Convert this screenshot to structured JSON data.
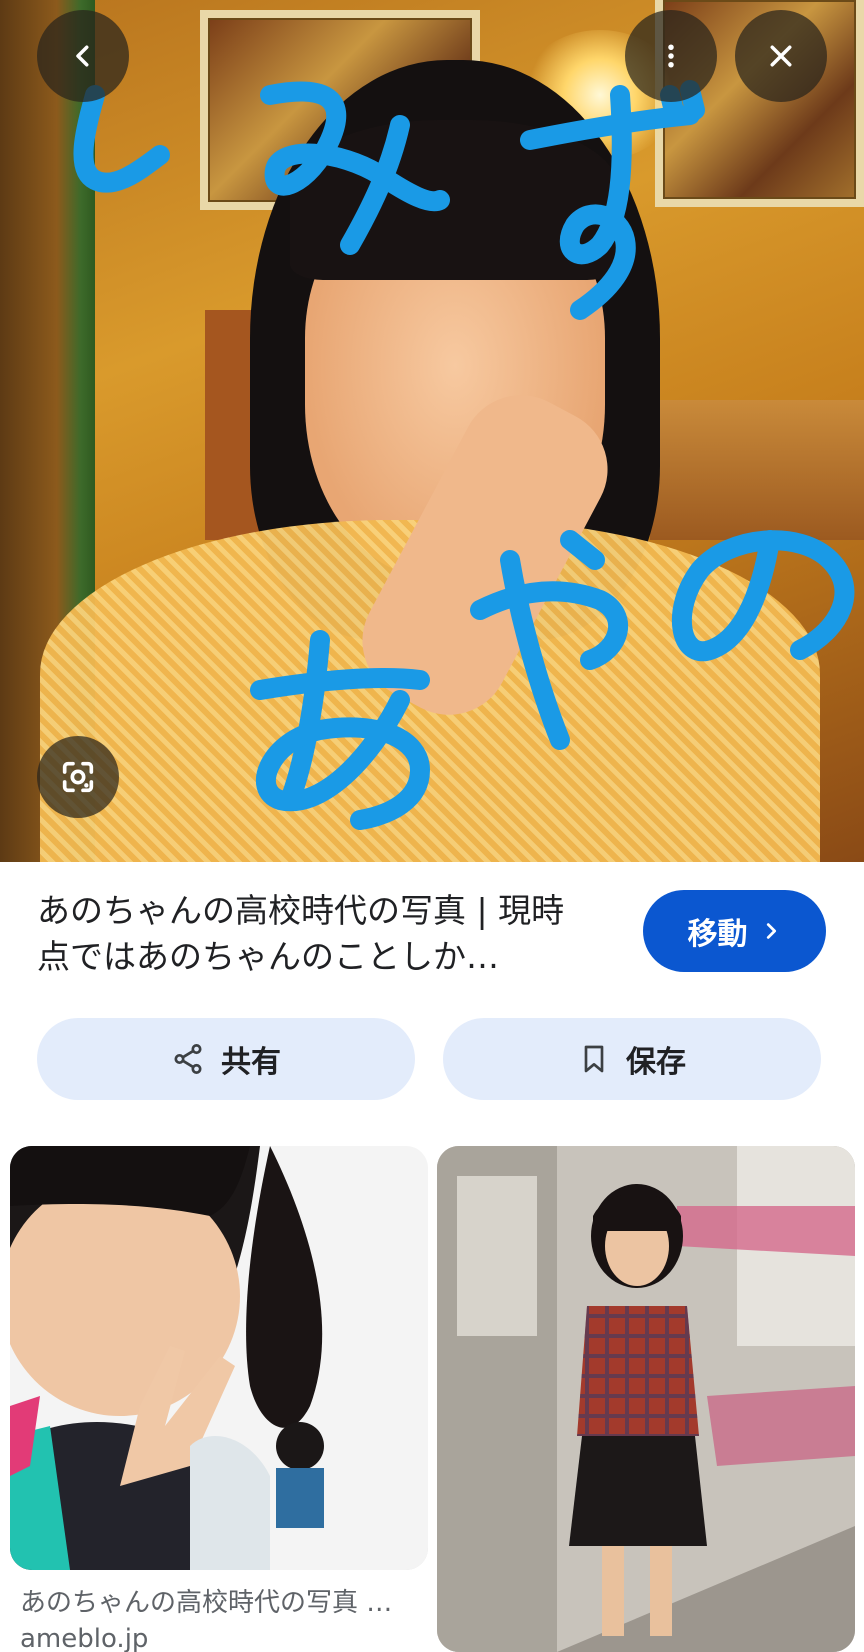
{
  "hero": {
    "overlay_text": "しみず あやの"
  },
  "buttons": {
    "back_icon": "chevron-left",
    "more_icon": "more-vertical",
    "close_icon": "close",
    "lens_icon": "google-lens"
  },
  "result": {
    "title": "あのちゃんの高校時代の写真 | 現時点ではあのちゃんのことしか…",
    "visit_label": "移動"
  },
  "actions": {
    "share_label": "共有",
    "save_label": "保存"
  },
  "related": [
    {
      "caption": "あのちゃんの高校時代の写真 …",
      "source": "ameblo.jp"
    },
    {
      "caption": "",
      "source": ""
    }
  ],
  "colors": {
    "primary": "#0b57d0",
    "pill_bg": "#e3ecfb",
    "scribble": "#1a9ae6"
  }
}
